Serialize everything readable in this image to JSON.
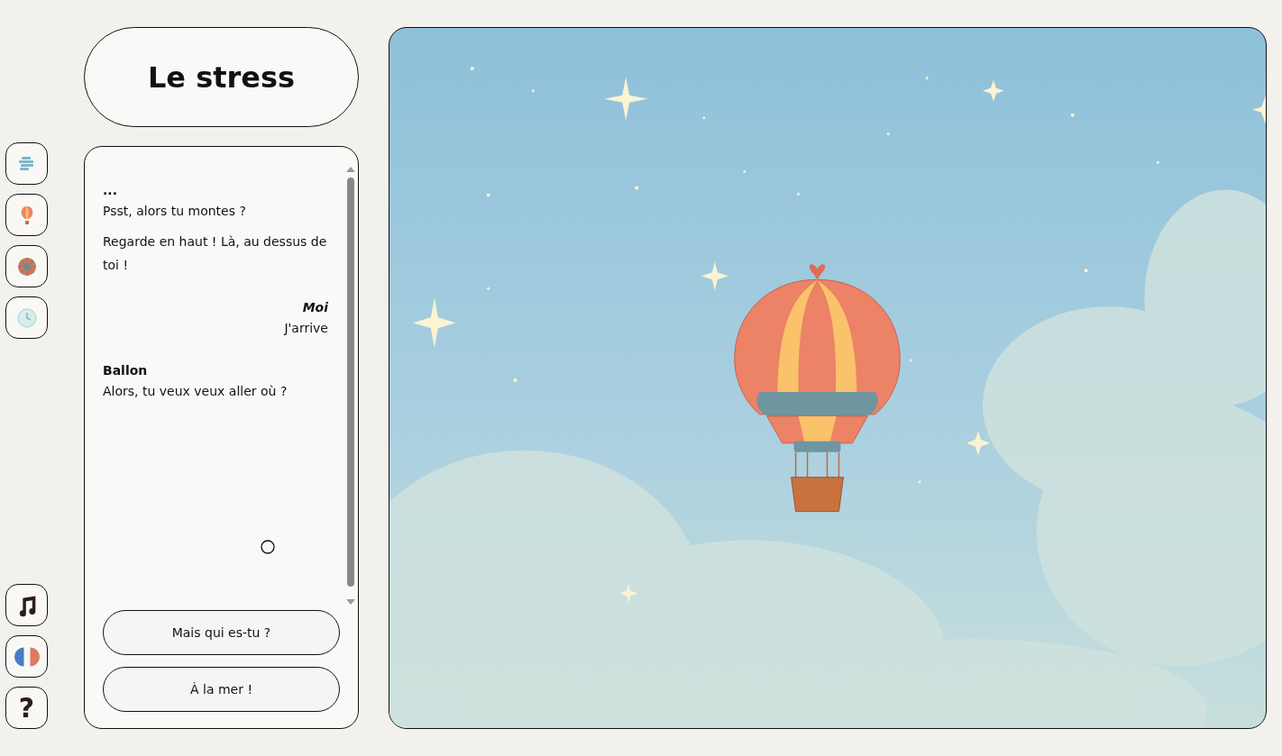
{
  "sidebar": {
    "top_buttons": [
      {
        "kind": "cloud"
      },
      {
        "kind": "balloon"
      },
      {
        "kind": "wheel"
      },
      {
        "kind": "clock"
      }
    ],
    "bottom_buttons": [
      {
        "kind": "music"
      },
      {
        "kind": "flag"
      },
      {
        "kind": "help",
        "label": "?"
      }
    ]
  },
  "title": "Le stress",
  "dialogue": {
    "messages": [
      {
        "kind": "other",
        "speaker": "...",
        "lines": [
          "Psst, alors tu montes ?",
          "Regarde en haut ! Là, au dessus de toi !"
        ]
      },
      {
        "kind": "player",
        "speaker": "Moi",
        "lines": [
          "J'arrive"
        ]
      },
      {
        "kind": "other",
        "speaker": "Ballon",
        "lines": [
          "Alors, tu veux veux aller où ?"
        ]
      }
    ],
    "choices": [
      "Mais qui es-tu ?",
      "À la mer !"
    ]
  }
}
